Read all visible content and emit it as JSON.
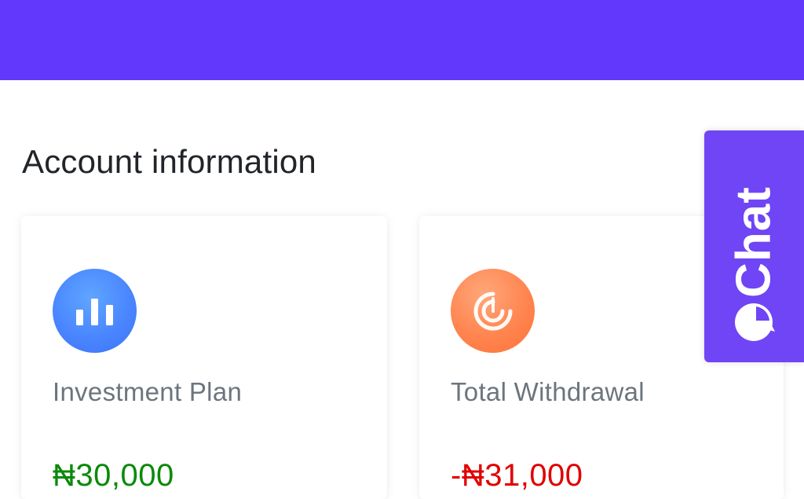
{
  "header": {
    "background_color": "#6338fd"
  },
  "page": {
    "title": "Account information"
  },
  "cards": [
    {
      "icon": "bar-chart-icon",
      "icon_color": "#4a86ff",
      "label": "Investment Plan",
      "value": "₦30,000",
      "value_color": "#0a8a0a"
    },
    {
      "icon": "target-icon",
      "icon_color": "#ff8550",
      "label": "Total Withdrawal",
      "value": "-₦31,000",
      "value_color": "#e00000"
    }
  ],
  "chat_widget": {
    "label": "Chat",
    "icon": "chat-bubble-icon",
    "background_color": "#6f45f5"
  }
}
